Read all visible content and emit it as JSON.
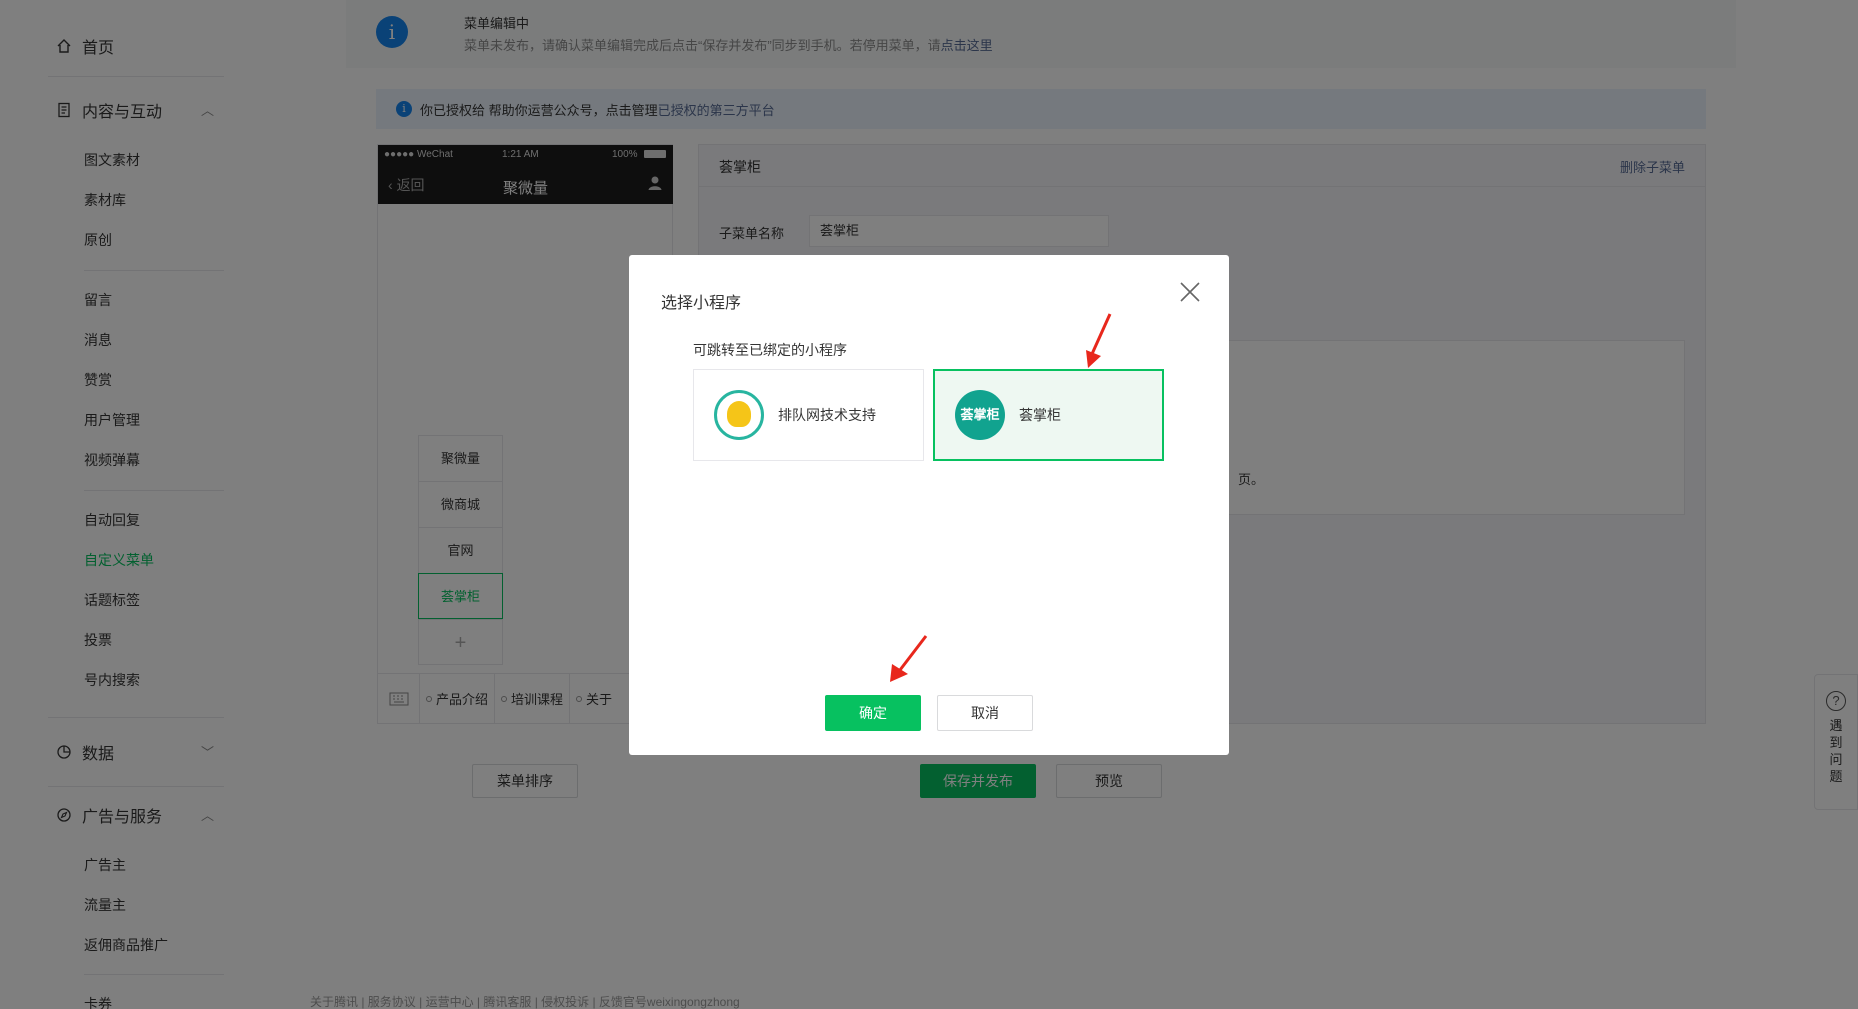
{
  "sidebar": {
    "home": "首页",
    "content": "内容与互动",
    "content_items": [
      "图文素材",
      "素材库",
      "原创",
      "留言",
      "消息",
      "赞赏",
      "用户管理",
      "视频弹幕",
      "自动回复",
      "自定义菜单",
      "话题标签",
      "投票",
      "号内搜索"
    ],
    "data": "数据",
    "ads": "广告与服务",
    "ads_items": [
      "广告主",
      "流量主",
      "返佣商品推广"
    ],
    "more": "卡券"
  },
  "notice": {
    "title": "菜单编辑中",
    "text": "菜单未发布，请确认菜单编辑完成后点击“保存并发布”同步到手机。若停用菜单，请",
    "link": "点击这里"
  },
  "auth": {
    "text": "你已授权给   帮助你运营公众号，点击管理",
    "link": "已授权的第三方平台"
  },
  "phone": {
    "carrier": "●●●●● WeChat",
    "time": "1:21 AM",
    "battery": "100%",
    "back": "返回",
    "title": "聚微量",
    "submenu": [
      "聚微量",
      "微商城",
      "官网",
      "荟掌柜"
    ],
    "add": "+",
    "menus": [
      "产品介绍",
      "培训课程",
      "关于"
    ]
  },
  "edit": {
    "title": "荟掌柜",
    "delete": "删除子菜单",
    "name_label": "子菜单名称",
    "name_value": "荟掌柜",
    "box_text": "页。"
  },
  "bottom": {
    "sort": "菜单排序",
    "publish": "保存并发布",
    "preview": "预览"
  },
  "footer": "关于腾讯 | 服务协议 | 运营中心 | 腾讯客服 | 侵权投诉 | 反馈官号weixingongzhong",
  "help": {
    "q": "?",
    "text": "遇到问题"
  },
  "modal": {
    "title": "选择小程序",
    "subtitle": "可跳转至已绑定的小程序",
    "apps": [
      {
        "name": "排队网技术支持",
        "selected": false
      },
      {
        "name": "荟掌柜",
        "selected": true,
        "logo_text": "荟掌柜"
      }
    ],
    "confirm": "确定",
    "cancel": "取消"
  },
  "colors": {
    "primary": "#07c160",
    "link": "#576b95",
    "info": "#1485ee",
    "arrow": "#e8271c"
  }
}
